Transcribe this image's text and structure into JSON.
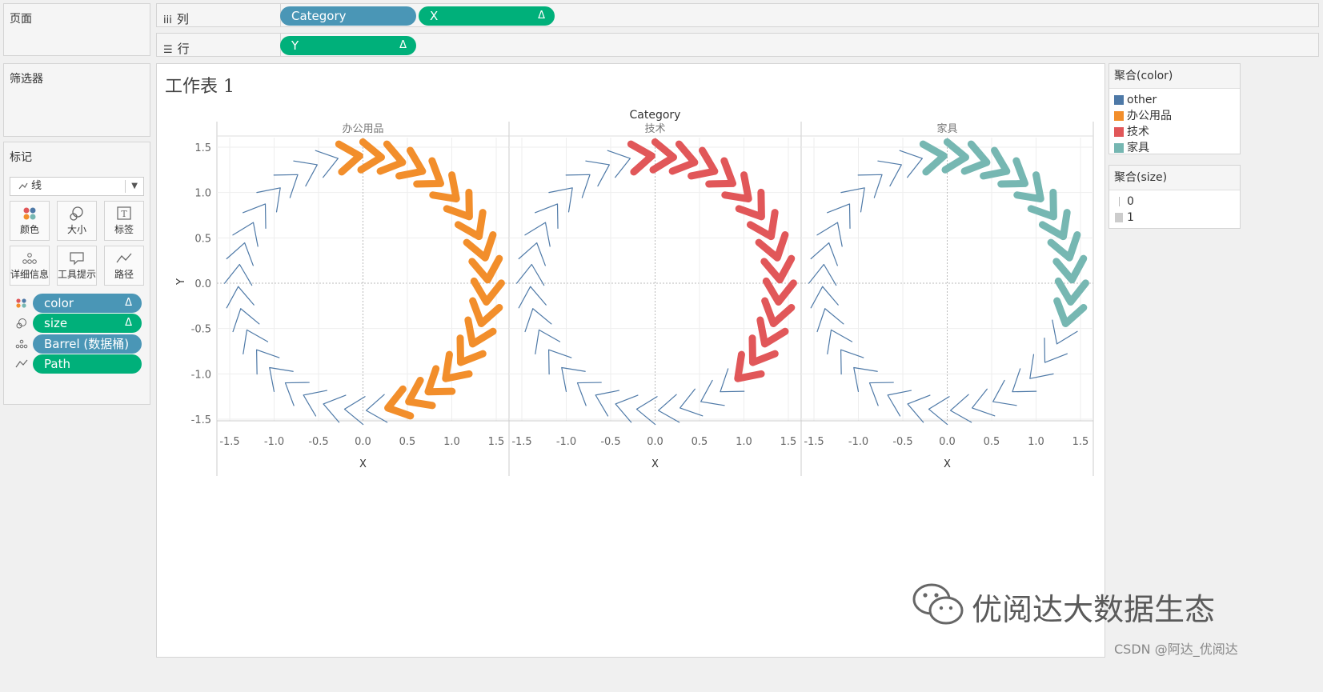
{
  "left": {
    "pages_title": "页面",
    "filters_title": "筛选器",
    "marks_title": "标记",
    "mark_type": "线",
    "mark_buttons": [
      {
        "label": "颜色",
        "icon": "color-icon"
      },
      {
        "label": "大小",
        "icon": "size-icon"
      },
      {
        "label": "标签",
        "icon": "label-icon"
      },
      {
        "label": "详细信息",
        "icon": "detail-icon"
      },
      {
        "label": "工具提示",
        "icon": "tooltip-icon"
      },
      {
        "label": "路径",
        "icon": "path-icon"
      }
    ],
    "mark_fields": [
      {
        "label": "color",
        "delta": "Δ",
        "icon": "color-icon"
      },
      {
        "label": "size",
        "delta": "Δ",
        "icon": "size-icon"
      },
      {
        "label": "Barrel (数据桶)",
        "delta": "",
        "icon": "detail-icon"
      },
      {
        "label": "Path",
        "delta": "",
        "icon": "path-icon"
      }
    ]
  },
  "shelves": {
    "columns_label": "列",
    "rows_label": "行",
    "columns_pills": [
      {
        "label": "Category",
        "delta": ""
      },
      {
        "label": "X",
        "delta": "Δ"
      }
    ],
    "rows_pills": [
      {
        "label": "Y",
        "delta": "Δ"
      }
    ]
  },
  "sheet": {
    "title": "工作表 1"
  },
  "legend_color": {
    "title": "聚合(color)",
    "items": [
      {
        "label": "other",
        "color": "#4e79a7"
      },
      {
        "label": "办公用品",
        "color": "#f28e2b"
      },
      {
        "label": "技术",
        "color": "#e15759"
      },
      {
        "label": "家具",
        "color": "#76b7b2"
      }
    ]
  },
  "legend_size": {
    "title": "聚合(size)",
    "items": [
      {
        "label": "0"
      },
      {
        "label": "1"
      }
    ]
  },
  "watermark": {
    "text": "优阅达大数据生态"
  },
  "csdn": {
    "text": "CSDN @阿达_优阅达"
  },
  "chart_data": {
    "type": "line",
    "title": "",
    "header_label": "Category",
    "xlabel": "X",
    "ylabel": "Y",
    "xlim": [
      -1.5,
      1.5
    ],
    "ylim": [
      -1.5,
      1.5
    ],
    "x_ticks": [
      "-1.5",
      "-1.0",
      "-0.5",
      "0.0",
      "0.5",
      "1.0",
      "1.5"
    ],
    "y_ticks": [
      "1.5",
      "1.0",
      "0.5",
      "0.0",
      "-0.5",
      "-1.0",
      "-1.5"
    ],
    "grid": true,
    "arrows_per_panel": 36,
    "radius": 1.4,
    "chevron_size": 0.22,
    "panels": [
      {
        "category": "办公用品",
        "highlight_color": "#f28e2b",
        "highlight_arrows": 18,
        "highlight_start_deg": 96
      },
      {
        "category": "技术",
        "highlight_color": "#e15759",
        "highlight_arrows": 15,
        "highlight_start_deg": 96
      },
      {
        "category": "家具",
        "highlight_color": "#76b7b2",
        "highlight_arrows": 12,
        "highlight_start_deg": 96
      }
    ],
    "other_color": "#4e79a7"
  }
}
